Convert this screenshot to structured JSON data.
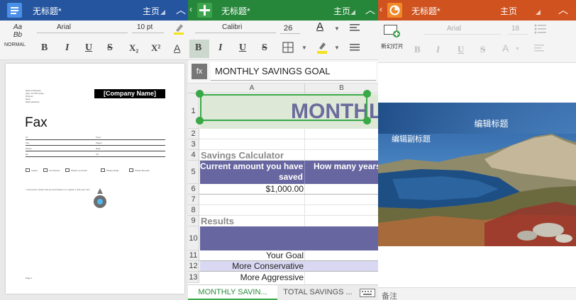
{
  "doc": {
    "title": "无标题*",
    "home": "主页",
    "style_name": "NORMAL",
    "style_sample": "Aa\nBb",
    "font": "Arial",
    "size": "10 pt",
    "format_buttons": [
      "B",
      "I",
      "U",
      "S",
      "X₂",
      "X²",
      "A"
    ],
    "company_name": "[Company Name]",
    "heading": "Fax",
    "address_lines": [
      "[Street Address]",
      "[City, ST ZIP Code]",
      "[Phone]",
      "[Fax]",
      "[Web address]"
    ],
    "field_left": [
      "To:",
      "Fax:",
      "Phone:",
      "Re:"
    ],
    "field_right": [
      "From:",
      "Pages:",
      "Date:",
      "CC:"
    ],
    "checkboxes": [
      "Urgent",
      "For Review",
      "Please Comment",
      "Please Reply",
      "Please Recycle"
    ],
    "comments": "• Comments: Select this text and delete it or replace it with your own.",
    "page_label": "Page 1"
  },
  "sheet": {
    "title": "无标题*",
    "home": "主页",
    "font": "Calibri",
    "size": "26",
    "format_buttons": [
      "B",
      "I",
      "U",
      "S"
    ],
    "fx_label": "fx",
    "formula": "MONTHLY SAVINGS GOAL",
    "col_a": "A",
    "col_b": "B",
    "rows": [
      "1",
      "2",
      "3",
      "4",
      "5",
      "6",
      "7",
      "8",
      "9",
      "10",
      "11",
      "12",
      "13"
    ],
    "big_title": "MONTHLY",
    "savings_calc": "Savings Calculator",
    "hdr_current_1": "Current amount you have",
    "hdr_current_2": "saved",
    "hdr_how_many": "How many years",
    "amount": "$1,000.00",
    "results": "Results",
    "your_goal": "Your Goal",
    "more_conservative": "More Conservative",
    "more_aggressive": "More Aggressive",
    "tab_1": "MONTHLY SAVIN...",
    "tab_2": "TOTAL SAVINGS ...",
    "colors": {
      "header": "#6866a0",
      "title_fill": "#dde9d6",
      "conservative": "#d8d8f2"
    }
  },
  "slide": {
    "title": "无标题*",
    "home": "主页",
    "new_slide": "新幻灯片",
    "font": "Arial",
    "size": "18",
    "format_buttons": [
      "B",
      "I",
      "U",
      "S",
      "A"
    ],
    "slide_title": "编辑标题",
    "slide_subtitle": "编辑副标题",
    "notes": "备注"
  }
}
